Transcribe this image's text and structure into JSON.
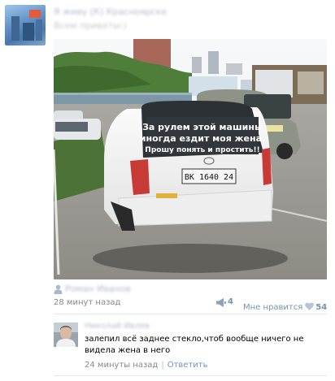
{
  "post": {
    "group_name": "Я живу [К] Красноярске",
    "text": "Всем приветы:)",
    "photo": {
      "sticker_line1": "За рулем этой машины",
      "sticker_line2": "иногда ездит моя жена.",
      "sticker_line3": "Прошу понять и простить!!",
      "plate": "ВК 1640 24"
    },
    "author": "Роман Иванов",
    "time": "28 минут назад",
    "reposts": "4",
    "like_label": "Мне нравится",
    "likes": "54"
  },
  "comment": {
    "author": "Николай Ивлев",
    "text": "залепил всё заднее стекло,чтоб вообще ничего не видела жена в него",
    "time": "24 минуты назад",
    "reply_label": "Ответить"
  },
  "colors": {
    "link": "#7593b0",
    "meta": "#888888"
  }
}
